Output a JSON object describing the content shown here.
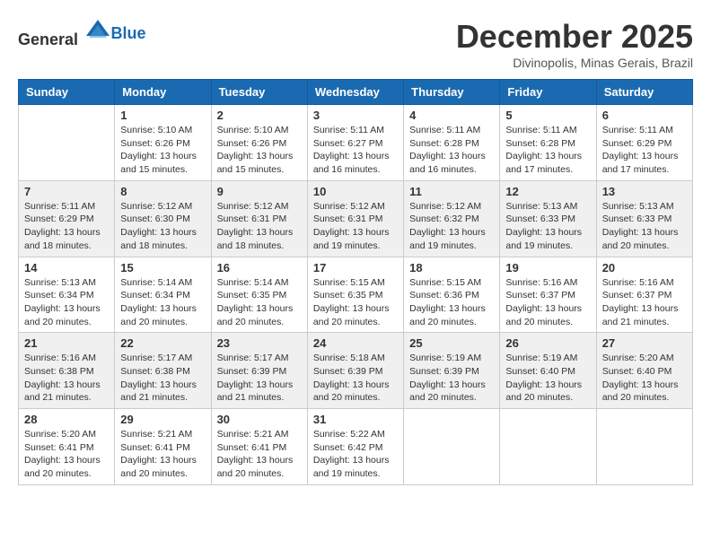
{
  "logo": {
    "general": "General",
    "blue": "Blue"
  },
  "title": "December 2025",
  "location": "Divinopolis, Minas Gerais, Brazil",
  "days_of_week": [
    "Sunday",
    "Monday",
    "Tuesday",
    "Wednesday",
    "Thursday",
    "Friday",
    "Saturday"
  ],
  "weeks": [
    [
      {
        "day": "",
        "info": ""
      },
      {
        "day": "1",
        "info": "Sunrise: 5:10 AM\nSunset: 6:26 PM\nDaylight: 13 hours\nand 15 minutes."
      },
      {
        "day": "2",
        "info": "Sunrise: 5:10 AM\nSunset: 6:26 PM\nDaylight: 13 hours\nand 15 minutes."
      },
      {
        "day": "3",
        "info": "Sunrise: 5:11 AM\nSunset: 6:27 PM\nDaylight: 13 hours\nand 16 minutes."
      },
      {
        "day": "4",
        "info": "Sunrise: 5:11 AM\nSunset: 6:28 PM\nDaylight: 13 hours\nand 16 minutes."
      },
      {
        "day": "5",
        "info": "Sunrise: 5:11 AM\nSunset: 6:28 PM\nDaylight: 13 hours\nand 17 minutes."
      },
      {
        "day": "6",
        "info": "Sunrise: 5:11 AM\nSunset: 6:29 PM\nDaylight: 13 hours\nand 17 minutes."
      }
    ],
    [
      {
        "day": "7",
        "info": "Sunrise: 5:11 AM\nSunset: 6:29 PM\nDaylight: 13 hours\nand 18 minutes."
      },
      {
        "day": "8",
        "info": "Sunrise: 5:12 AM\nSunset: 6:30 PM\nDaylight: 13 hours\nand 18 minutes."
      },
      {
        "day": "9",
        "info": "Sunrise: 5:12 AM\nSunset: 6:31 PM\nDaylight: 13 hours\nand 18 minutes."
      },
      {
        "day": "10",
        "info": "Sunrise: 5:12 AM\nSunset: 6:31 PM\nDaylight: 13 hours\nand 19 minutes."
      },
      {
        "day": "11",
        "info": "Sunrise: 5:12 AM\nSunset: 6:32 PM\nDaylight: 13 hours\nand 19 minutes."
      },
      {
        "day": "12",
        "info": "Sunrise: 5:13 AM\nSunset: 6:33 PM\nDaylight: 13 hours\nand 19 minutes."
      },
      {
        "day": "13",
        "info": "Sunrise: 5:13 AM\nSunset: 6:33 PM\nDaylight: 13 hours\nand 20 minutes."
      }
    ],
    [
      {
        "day": "14",
        "info": "Sunrise: 5:13 AM\nSunset: 6:34 PM\nDaylight: 13 hours\nand 20 minutes."
      },
      {
        "day": "15",
        "info": "Sunrise: 5:14 AM\nSunset: 6:34 PM\nDaylight: 13 hours\nand 20 minutes."
      },
      {
        "day": "16",
        "info": "Sunrise: 5:14 AM\nSunset: 6:35 PM\nDaylight: 13 hours\nand 20 minutes."
      },
      {
        "day": "17",
        "info": "Sunrise: 5:15 AM\nSunset: 6:35 PM\nDaylight: 13 hours\nand 20 minutes."
      },
      {
        "day": "18",
        "info": "Sunrise: 5:15 AM\nSunset: 6:36 PM\nDaylight: 13 hours\nand 20 minutes."
      },
      {
        "day": "19",
        "info": "Sunrise: 5:16 AM\nSunset: 6:37 PM\nDaylight: 13 hours\nand 20 minutes."
      },
      {
        "day": "20",
        "info": "Sunrise: 5:16 AM\nSunset: 6:37 PM\nDaylight: 13 hours\nand 21 minutes."
      }
    ],
    [
      {
        "day": "21",
        "info": "Sunrise: 5:16 AM\nSunset: 6:38 PM\nDaylight: 13 hours\nand 21 minutes."
      },
      {
        "day": "22",
        "info": "Sunrise: 5:17 AM\nSunset: 6:38 PM\nDaylight: 13 hours\nand 21 minutes."
      },
      {
        "day": "23",
        "info": "Sunrise: 5:17 AM\nSunset: 6:39 PM\nDaylight: 13 hours\nand 21 minutes."
      },
      {
        "day": "24",
        "info": "Sunrise: 5:18 AM\nSunset: 6:39 PM\nDaylight: 13 hours\nand 20 minutes."
      },
      {
        "day": "25",
        "info": "Sunrise: 5:19 AM\nSunset: 6:39 PM\nDaylight: 13 hours\nand 20 minutes."
      },
      {
        "day": "26",
        "info": "Sunrise: 5:19 AM\nSunset: 6:40 PM\nDaylight: 13 hours\nand 20 minutes."
      },
      {
        "day": "27",
        "info": "Sunrise: 5:20 AM\nSunset: 6:40 PM\nDaylight: 13 hours\nand 20 minutes."
      }
    ],
    [
      {
        "day": "28",
        "info": "Sunrise: 5:20 AM\nSunset: 6:41 PM\nDaylight: 13 hours\nand 20 minutes."
      },
      {
        "day": "29",
        "info": "Sunrise: 5:21 AM\nSunset: 6:41 PM\nDaylight: 13 hours\nand 20 minutes."
      },
      {
        "day": "30",
        "info": "Sunrise: 5:21 AM\nSunset: 6:41 PM\nDaylight: 13 hours\nand 20 minutes."
      },
      {
        "day": "31",
        "info": "Sunrise: 5:22 AM\nSunset: 6:42 PM\nDaylight: 13 hours\nand 19 minutes."
      },
      {
        "day": "",
        "info": ""
      },
      {
        "day": "",
        "info": ""
      },
      {
        "day": "",
        "info": ""
      }
    ]
  ]
}
